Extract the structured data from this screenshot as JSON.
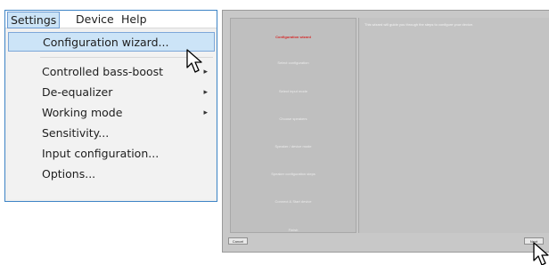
{
  "menubar": {
    "items": [
      {
        "label": "Settings"
      },
      {
        "label": "Device"
      },
      {
        "label": "Help"
      }
    ]
  },
  "settings_menu": {
    "items": [
      {
        "label": "Configuration wizard...",
        "has_submenu": false,
        "highlighted": true
      },
      {
        "label": "Controlled bass-boost",
        "has_submenu": true
      },
      {
        "label": "De-equalizer",
        "has_submenu": true
      },
      {
        "label": "Working mode",
        "has_submenu": true
      },
      {
        "label": "Sensitivity...",
        "has_submenu": false
      },
      {
        "label": "Input configuration...",
        "has_submenu": false
      },
      {
        "label": "Options...",
        "has_submenu": false
      }
    ],
    "submenu_glyph": "▸"
  },
  "wizard": {
    "steps": [
      {
        "label": "Configuration wizard",
        "current": true
      },
      {
        "label": "Select configuration"
      },
      {
        "label": "Select input mode"
      },
      {
        "label": "Choose speakers"
      },
      {
        "label": "Speaker / device mode"
      },
      {
        "label": "Speaker configuration steps"
      },
      {
        "label": "Connect & Start device"
      },
      {
        "label": "Finish"
      }
    ],
    "intro_text": "This wizard will guide you through the steps to configure your device.",
    "cancel_label": "Cancel",
    "next_label": "Next"
  },
  "colors": {
    "menu_highlight": "#cce4f7",
    "menu_border": "#3c83c5",
    "current_step": "#d52b2b",
    "wizard_bg": "#c8c8c8"
  }
}
